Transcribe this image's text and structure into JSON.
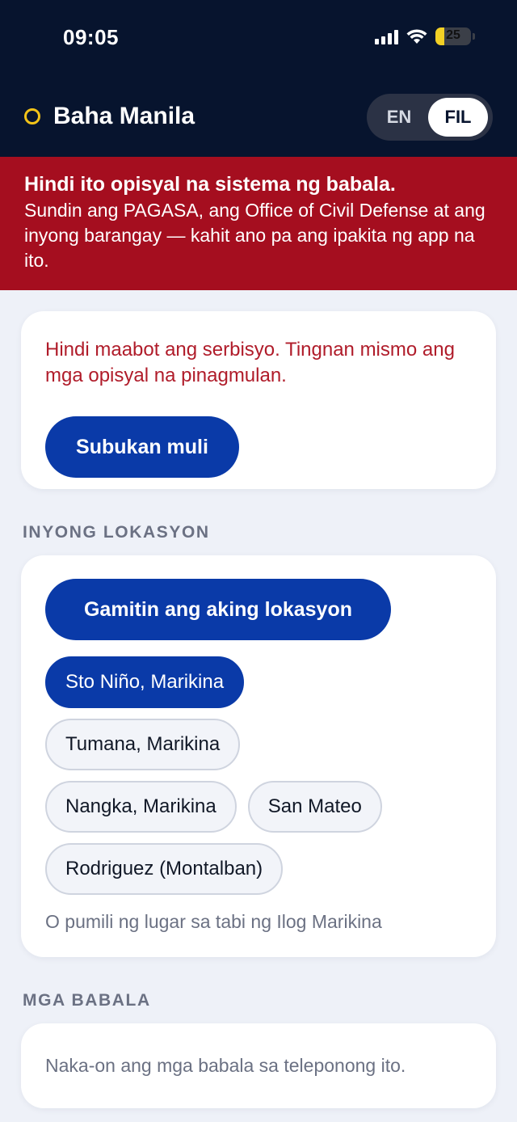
{
  "status_bar": {
    "time": "09:05",
    "battery": "25"
  },
  "header": {
    "title": "Baha Manila",
    "lang_en": "EN",
    "lang_fil": "FIL"
  },
  "banner": {
    "title": "Hindi ito opisyal na sistema ng babala.",
    "body": "Sundin ang PAGASA, ang Office of Civil Defense at ang inyong barangay — kahit ano pa ang ipakita ng app na ito."
  },
  "error_card": {
    "message": "Hindi maabot ang serbisyo. Tingnan mismo ang mga opisyal na pinagmulan.",
    "retry_label": "Subukan muli"
  },
  "location": {
    "section_label": "INYONG LOKASYON",
    "use_location_label": "Gamitin ang aking lokasyon",
    "chips": [
      {
        "label": "Sto Niño, Marikina",
        "selected": true
      },
      {
        "label": "Tumana, Marikina",
        "selected": false
      },
      {
        "label": "Nangka, Marikina",
        "selected": false
      },
      {
        "label": "San Mateo",
        "selected": false
      },
      {
        "label": "Rodriguez (Montalban)",
        "selected": false
      }
    ],
    "hint": "O pumili ng lugar sa tabi ng Ilog Marikina"
  },
  "alerts": {
    "section_label": "MGA BABALA",
    "status_text": "Naka-on ang mga babala sa teleponong ito."
  },
  "colors": {
    "navy": "#07142e",
    "primary": "#0a3aa8",
    "warning": "#a50e1f",
    "accent_ring": "#f2c318"
  }
}
